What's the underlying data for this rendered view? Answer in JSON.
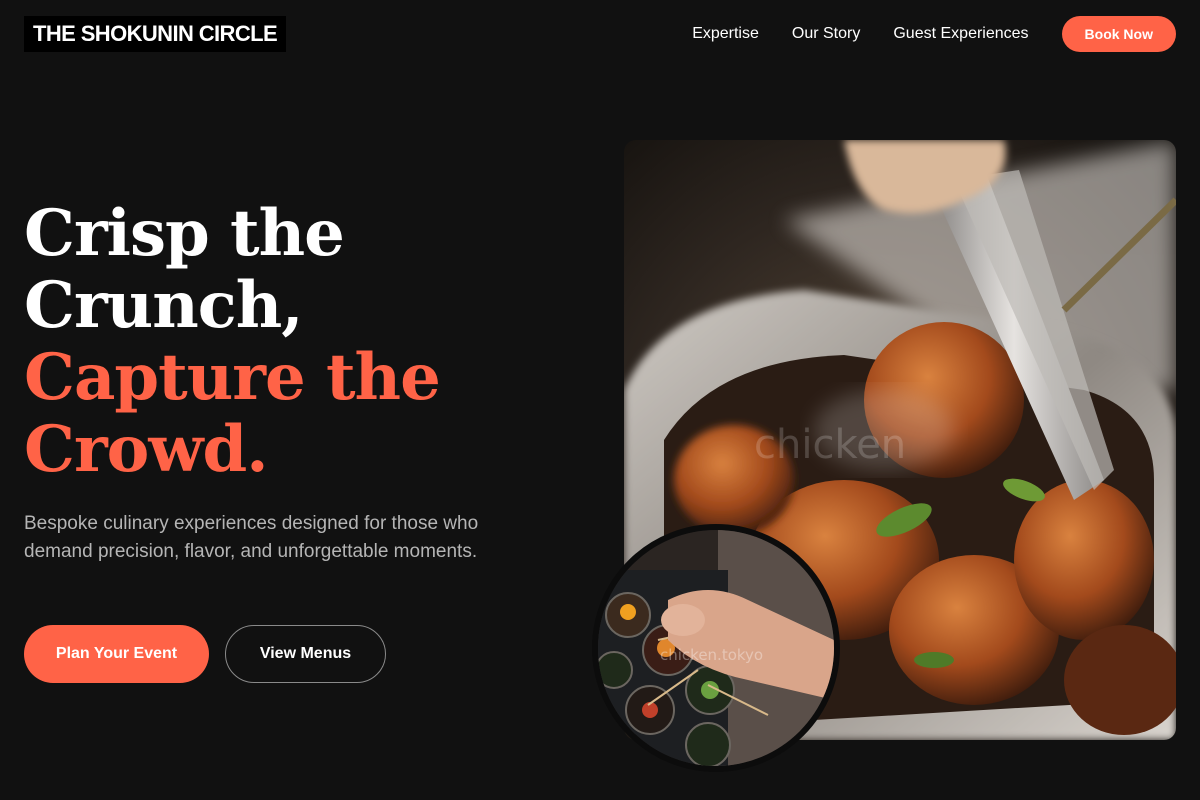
{
  "header": {
    "logo_text": "THE SHOKUNIN CIRCLE",
    "nav": [
      "Expertise",
      "Our Story",
      "Guest Experiences"
    ],
    "cta_label": "Book Now"
  },
  "hero": {
    "headline_white": [
      "Crisp the",
      "Crunch,"
    ],
    "headline_accent": [
      "Capture the",
      "Crowd."
    ],
    "subtext": "Bespoke culinary experiences designed for those who demand precision, flavor, and unforgettable moments.",
    "primary_button": "Plan Your Event",
    "secondary_button": "View Menus"
  },
  "images": {
    "main_watermark": "chicken",
    "circle_watermark": "chicken.tokyo"
  },
  "colors": {
    "background": "#111111",
    "accent": "#ff6347",
    "muted_text": "#b5b5b5"
  }
}
